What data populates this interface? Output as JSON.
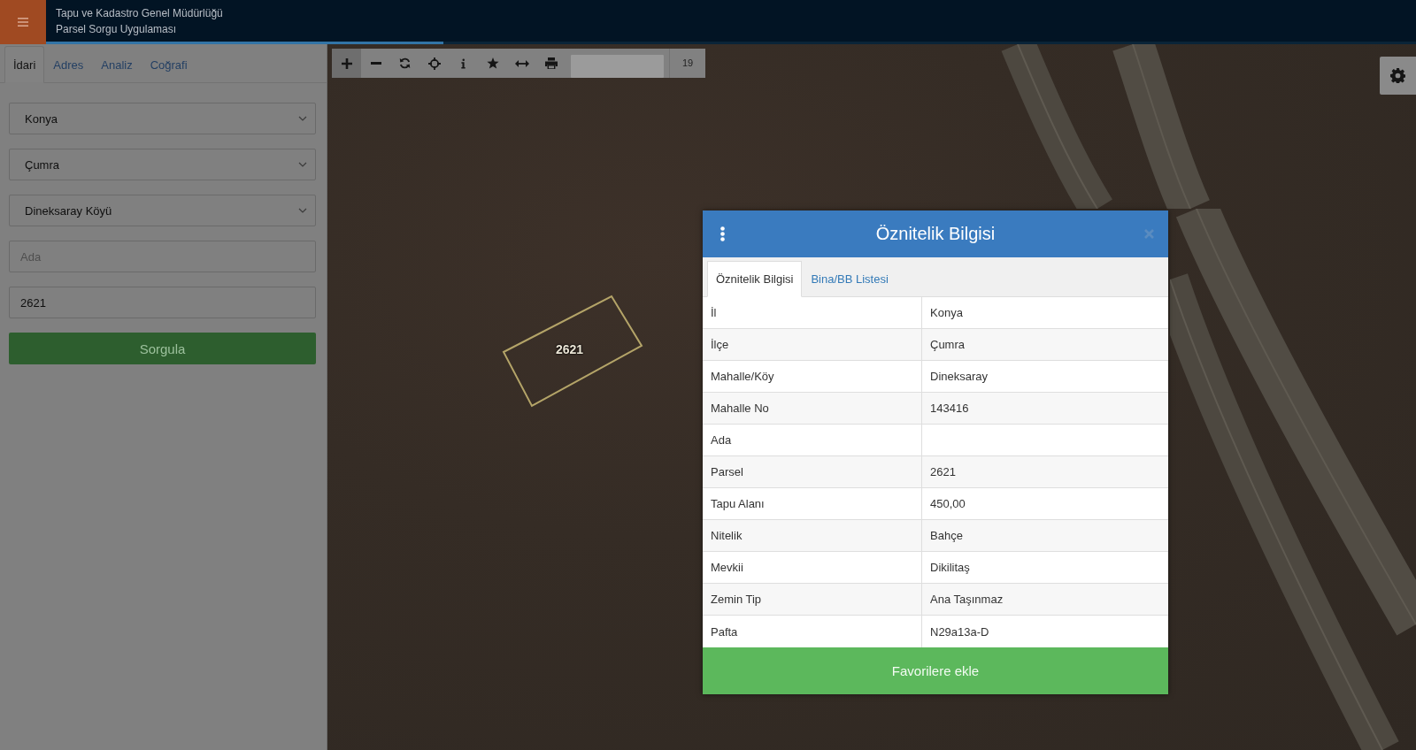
{
  "header": {
    "title": "Tapu ve Kadastro Genel Müdürlüğü",
    "subtitle": "Parsel Sorgu Uygulaması",
    "progress": {
      "level": 0.29
    }
  },
  "sidebar": {
    "tabs": [
      {
        "label": "İdari",
        "selected": true
      },
      {
        "label": "Adres",
        "selected": false
      },
      {
        "label": "Analiz",
        "selected": false
      },
      {
        "label": "Coğrafi",
        "selected": false
      }
    ],
    "fields": [
      {
        "kind": "select",
        "value": "Konya"
      },
      {
        "kind": "select",
        "value": "Çumra"
      },
      {
        "kind": "select",
        "value": "Dineksaray Köyü"
      },
      {
        "kind": "input",
        "placeholder": "Ada"
      },
      {
        "kind": "input",
        "value": "2621"
      }
    ],
    "submit_button": "Sorgula"
  },
  "map": {
    "toolbar": {
      "tools": [
        {
          "kind": "zoom-in",
          "active": true
        },
        {
          "kind": "zoom-out",
          "active": false
        },
        {
          "kind": "refresh",
          "active": false
        },
        {
          "kind": "locate",
          "active": false
        },
        {
          "kind": "info",
          "active": false
        },
        {
          "kind": "favorite",
          "active": false
        },
        {
          "kind": "measure",
          "active": false
        },
        {
          "kind": "print",
          "active": false
        }
      ],
      "zoom_level": "19"
    },
    "parcel_label": "2621"
  },
  "dialog": {
    "title": "Öznitelik Bilgisi",
    "tabs": [
      {
        "label": "Öznitelik Bilgisi",
        "selected": true
      },
      {
        "label": "Bina/BB Listesi",
        "selected": false
      }
    ],
    "rows": [
      {
        "label": "İl",
        "value": "Konya"
      },
      {
        "label": "İlçe",
        "value": "Çumra"
      },
      {
        "label": "Mahalle/Köy",
        "value": "Dineksaray"
      },
      {
        "label": "Mahalle No",
        "value": "143416"
      },
      {
        "label": "Ada"
      },
      {
        "label": "Parsel",
        "value": "2621"
      },
      {
        "label": "Tapu Alanı",
        "value": "450,00"
      },
      {
        "label": "Nitelik",
        "value": "Bahçe"
      },
      {
        "label": "Mevkii",
        "value": "Dikilitaş"
      },
      {
        "label": "Zemin Tip",
        "value": "Ana Taşınmaz"
      },
      {
        "label": "Pafta",
        "value": "N29a13a-D"
      }
    ],
    "button": "Favorilere ekle"
  }
}
